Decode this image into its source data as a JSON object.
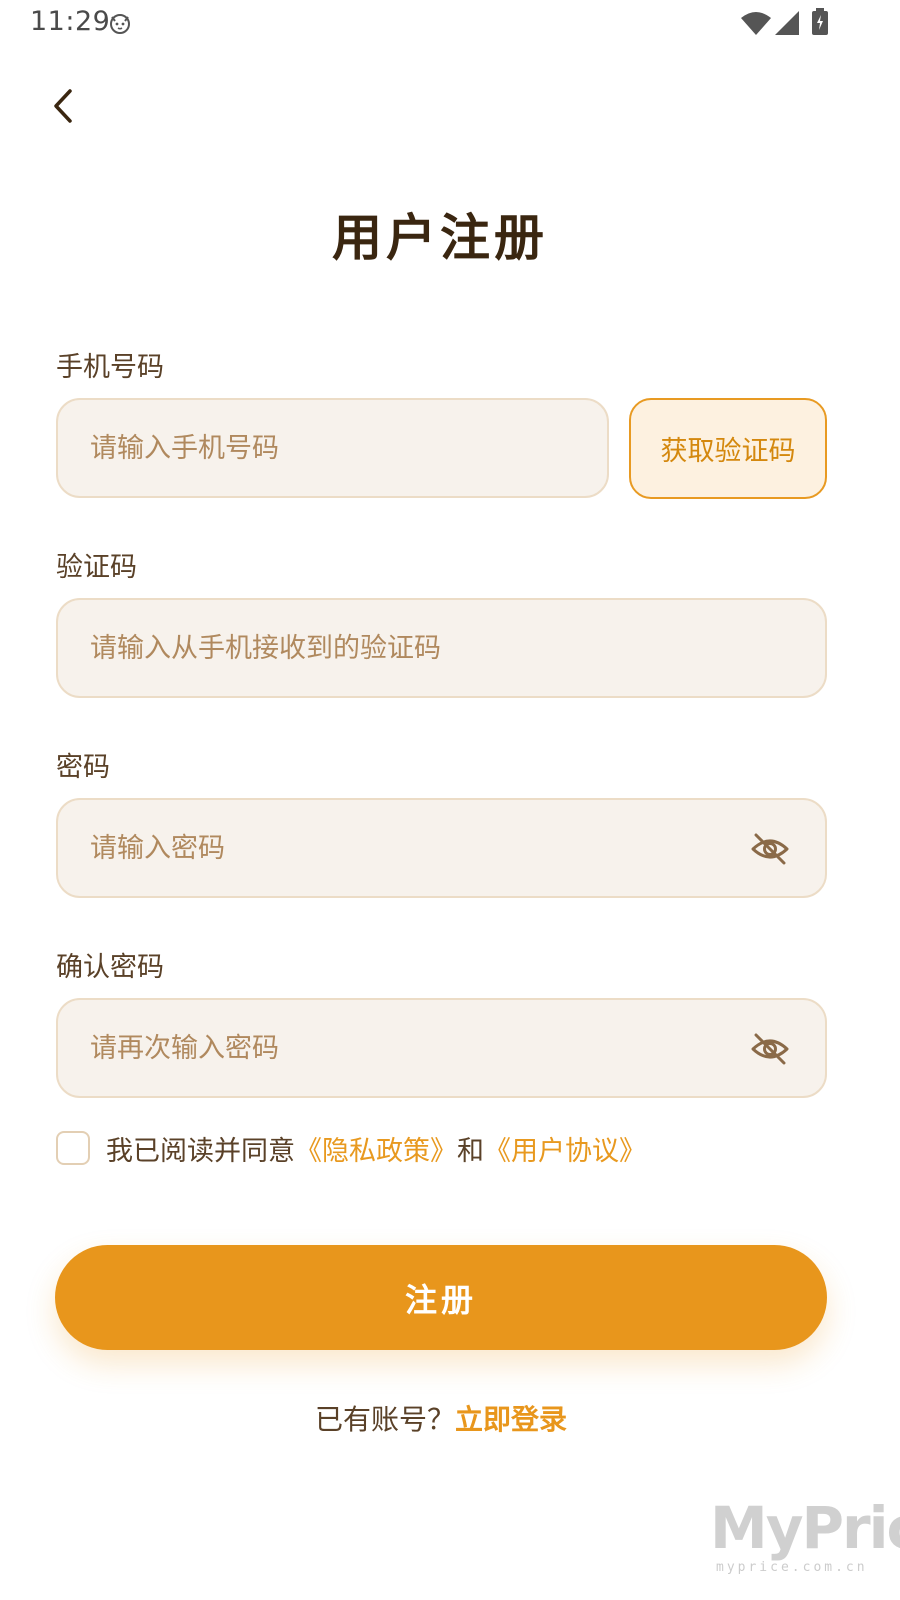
{
  "status_bar": {
    "time": "11:29"
  },
  "title": "用户注册",
  "phone": {
    "label": "手机号码",
    "placeholder": "请输入手机号码",
    "get_code_label": "获取验证码"
  },
  "code": {
    "label": "验证码",
    "placeholder": "请输入从手机接收到的验证码"
  },
  "password": {
    "label": "密码",
    "placeholder": "请输入密码"
  },
  "confirm_password": {
    "label": "确认密码",
    "placeholder": "请再次输入密码"
  },
  "agreement": {
    "prefix": "我已阅读并同意",
    "privacy_link": "《隐私政策》",
    "and": "和",
    "user_link": "《用户协议》"
  },
  "register_label": "注册",
  "login": {
    "question": "已有账号？",
    "link": "立即登录"
  },
  "watermark": {
    "logo": "MyPrice",
    "sub": "myprice.com.cn"
  },
  "colors": {
    "accent": "#e8961c",
    "input_bg": "#f7f2ec",
    "input_border": "#ecdcc6",
    "title": "#3a2610"
  },
  "icons": {
    "back": "chevron-left-icon",
    "eye": "eye-off-icon",
    "wifi": "wifi-icon",
    "signal": "signal-icon",
    "battery": "battery-charging-icon",
    "cat": "cat-face-icon"
  }
}
